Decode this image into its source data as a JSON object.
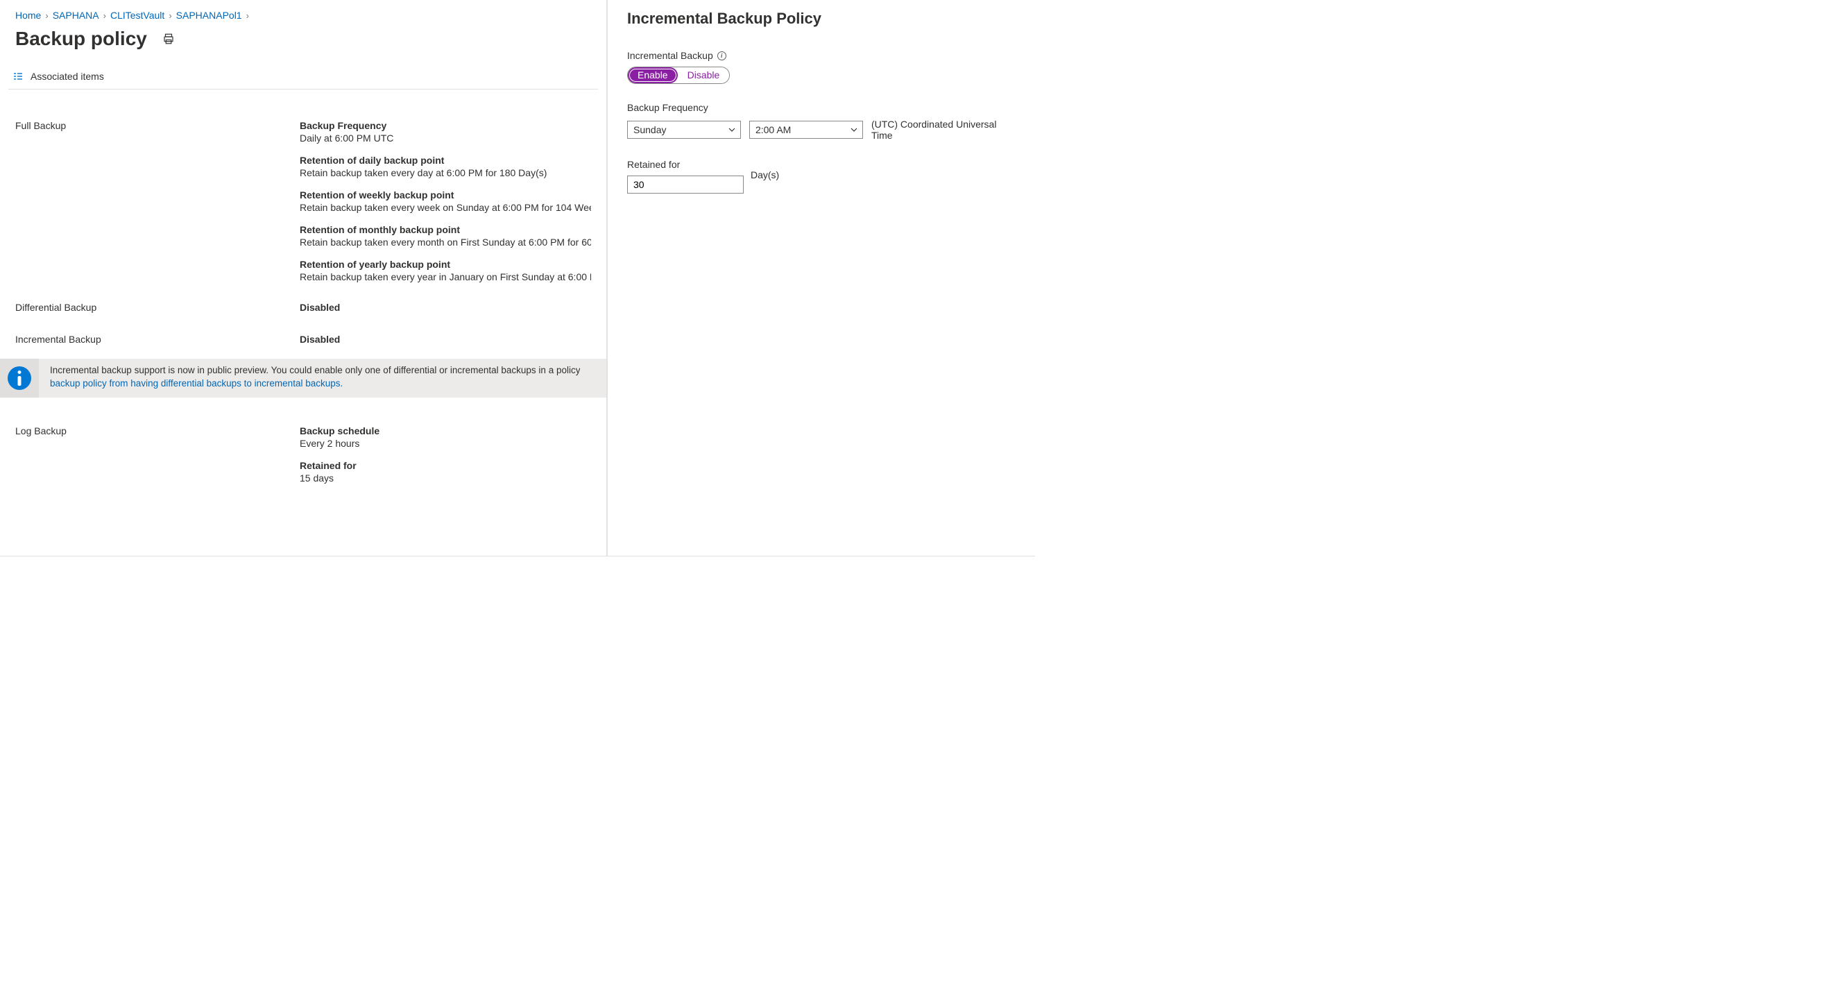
{
  "breadcrumb": {
    "items": [
      "Home",
      "SAPHANA",
      "CLITestVault",
      "SAPHANAPol1"
    ]
  },
  "page": {
    "title": "Backup policy",
    "associated_items": "Associated items"
  },
  "sections": {
    "full_backup": {
      "label": "Full Backup",
      "freq_k": "Backup Frequency",
      "freq_v": "Daily at 6:00 PM UTC",
      "daily_k": "Retention of daily backup point",
      "daily_v": "Retain backup taken every day at 6:00 PM for 180 Day(s)",
      "weekly_k": "Retention of weekly backup point",
      "weekly_v": "Retain backup taken every week on Sunday at 6:00 PM for 104 Wee",
      "monthly_k": "Retention of monthly backup point",
      "monthly_v": "Retain backup taken every month on First Sunday at 6:00 PM for 60",
      "yearly_k": "Retention of yearly backup point",
      "yearly_v": "Retain backup taken every year in January on First Sunday at 6:00 P"
    },
    "differential": {
      "label": "Differential Backup",
      "status": "Disabled"
    },
    "incremental": {
      "label": "Incremental Backup",
      "status": "Disabled"
    },
    "info": {
      "line1": "Incremental backup support is now in public preview. You could enable only one of differential or incremental backups in a policy",
      "link": "backup policy from having differential backups to incremental backups."
    },
    "log": {
      "label": "Log Backup",
      "sched_k": "Backup schedule",
      "sched_v": "Every 2 hours",
      "retain_k": "Retained for",
      "retain_v": "15 days"
    }
  },
  "panel": {
    "title": "Incremental Backup Policy",
    "inc_label": "Incremental Backup",
    "enable": "Enable",
    "disable": "Disable",
    "freq_label": "Backup Frequency",
    "day": "Sunday",
    "time": "2:00 AM",
    "tz": "(UTC) Coordinated Universal Time",
    "retain_label": "Retained for",
    "retain_value": "30",
    "retain_unit": "Day(s)"
  }
}
